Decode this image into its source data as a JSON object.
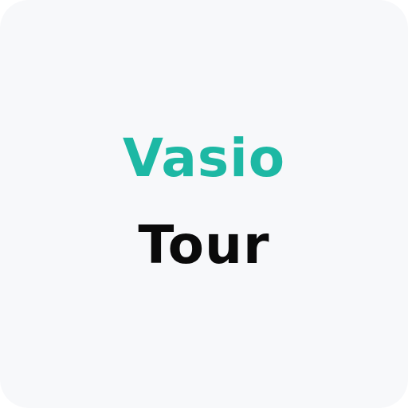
{
  "logo": {
    "line1": "Vasio",
    "line2": "Tour"
  },
  "colors": {
    "background": "#f7f8fa",
    "accent": "#1db8a4",
    "text": "#0a0a0a"
  }
}
